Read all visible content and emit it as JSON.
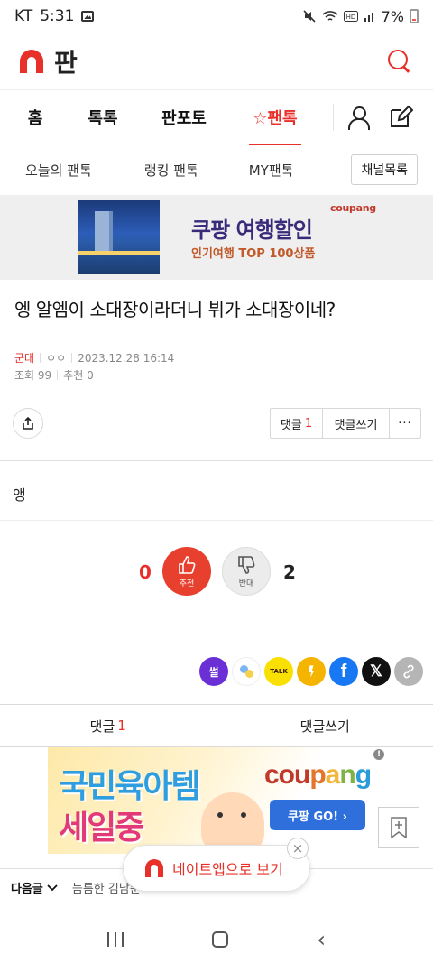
{
  "status": {
    "carrier": "KT",
    "time": "5:31",
    "battery": "7%"
  },
  "header": {
    "app_title": "판"
  },
  "main_nav": {
    "tabs": [
      {
        "label": "홈"
      },
      {
        "label": "톡톡"
      },
      {
        "label": "판포토"
      },
      {
        "label": "☆팬톡"
      }
    ]
  },
  "sub_nav": {
    "items": [
      {
        "label": "오늘의 팬톡"
      },
      {
        "label": "랭킹 팬톡"
      },
      {
        "label": "MY팬톡"
      }
    ],
    "channel_button": "채널목록"
  },
  "ad_top": {
    "brand": "coupang",
    "headline": "쿠팡 여행할인",
    "sub": "인기여행 TOP 100상품"
  },
  "post": {
    "title": "엥 알엠이 소대장이라더니 뷔가 소대장이네?",
    "category": "군대",
    "author": "ㅇㅇ",
    "date": "2023.12.28 16:14",
    "views": "조회 99",
    "recommends": "추천 0",
    "body": "앵"
  },
  "actions": {
    "comment_label": "댓글",
    "comment_count": "1",
    "write_comment": "댓글쓰기",
    "more": "···"
  },
  "votes": {
    "up_count": "0",
    "up_label": "추천",
    "down_count": "2",
    "down_label": "반대"
  },
  "share": {
    "ssul": "썰",
    "kakao": "TALK",
    "facebook": "f",
    "x": "𝕏"
  },
  "comment_bar": {
    "comment_label": "댓글",
    "comment_count": "1",
    "write_comment": "댓글쓰기"
  },
  "ad_bottom": {
    "line1": "국민육아템",
    "line2": "세일중",
    "brand_parts": [
      "cou",
      "p",
      "a",
      "n",
      "g"
    ],
    "go": "쿠팡 GO! ›",
    "info": "!"
  },
  "next_post": {
    "label": "다음글",
    "title": "늠름한 김남준"
  },
  "app_popup": {
    "text": "네이트앱으로 보기",
    "close": "×"
  },
  "colors": {
    "accent": "#e8302a"
  }
}
